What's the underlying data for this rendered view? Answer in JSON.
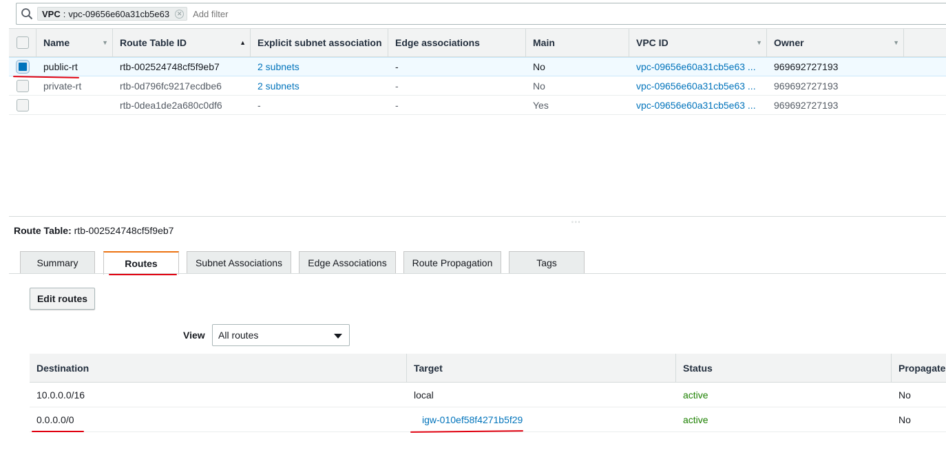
{
  "filter": {
    "token_key": "VPC",
    "token_sep": ":",
    "token_value": "vpc-09656e60a31cb5e63",
    "token_close": "⊗",
    "placeholder": "Add filter"
  },
  "route_tables": {
    "columns": [
      "Name",
      "Route Table ID",
      "Explicit subnet association",
      "Edge associations",
      "Main",
      "VPC ID",
      "Owner"
    ],
    "rows": [
      {
        "name": "public-rt",
        "id": "rtb-002524748cf5f9eb7",
        "subnets": "2 subnets",
        "edge": "-",
        "main": "No",
        "vpc": "vpc-09656e60a31cb5e63 ...",
        "owner": "969692727193",
        "selected": true
      },
      {
        "name": "private-rt",
        "id": "rtb-0d796fc9217ecdbe6",
        "subnets": "2 subnets",
        "edge": "-",
        "main": "No",
        "vpc": "vpc-09656e60a31cb5e63 ...",
        "owner": "969692727193",
        "selected": false
      },
      {
        "name": "",
        "id": "rtb-0dea1de2a680c0df6",
        "subnets": "-",
        "edge": "-",
        "main": "Yes",
        "vpc": "vpc-09656e60a31cb5e63 ...",
        "owner": "969692727193",
        "selected": false
      }
    ]
  },
  "splitter_grip": "◦◦◦",
  "detail": {
    "title_label": "Route Table:",
    "title_value": "rtb-002524748cf5f9eb7",
    "tabs": [
      "Summary",
      "Routes",
      "Subnet Associations",
      "Edge Associations",
      "Route Propagation",
      "Tags"
    ],
    "active_tab": "Routes",
    "edit_button": "Edit routes",
    "view_label": "View",
    "view_selected": "All routes"
  },
  "routes": {
    "columns": [
      "Destination",
      "Target",
      "Status",
      "Propagated"
    ],
    "rows": [
      {
        "destination": "10.0.0.0/16",
        "target": "local",
        "target_link": false,
        "status": "active",
        "propagated": "No"
      },
      {
        "destination": "0.0.0.0/0",
        "target": "igw-010ef58f4271b5f29",
        "target_link": true,
        "status": "active",
        "propagated": "No"
      }
    ]
  },
  "colors": {
    "link": "#0073bb",
    "active_status": "#1d8102",
    "tab_accent": "#ec7211",
    "annotation": "#e0000f"
  }
}
